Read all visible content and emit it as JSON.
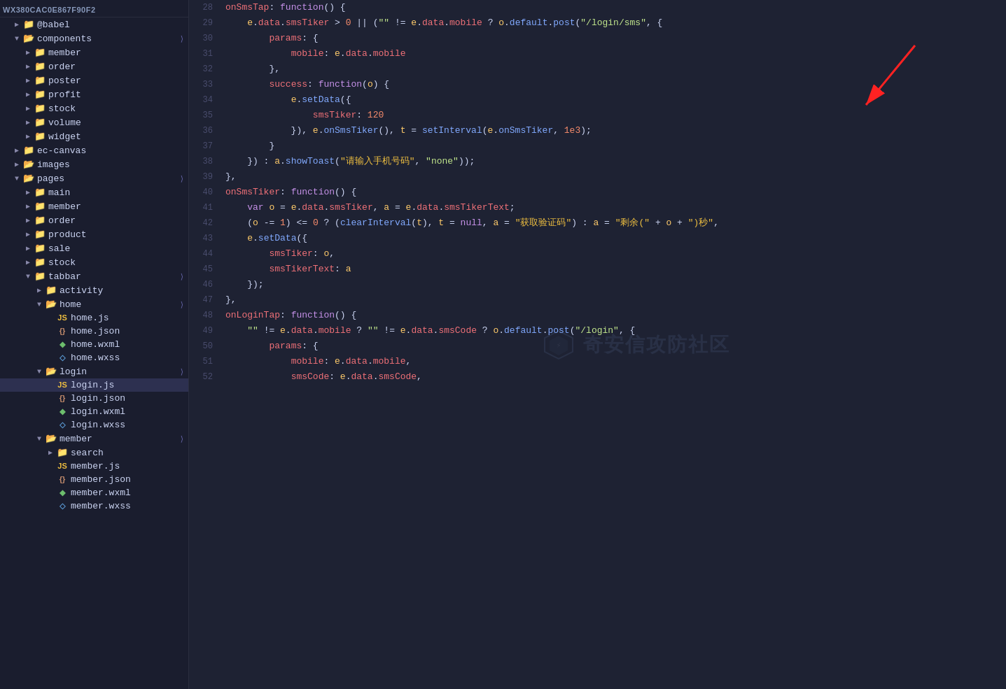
{
  "sidebar": {
    "title": "WX380CAC0E867F90F2",
    "items": [
      {
        "id": "babel",
        "label": "@babel",
        "type": "folder",
        "indent": 1,
        "expanded": false,
        "arrow": "▶"
      },
      {
        "id": "components",
        "label": "components",
        "type": "folder-blue",
        "indent": 1,
        "expanded": true,
        "arrow": "▼"
      },
      {
        "id": "member",
        "label": "member",
        "type": "folder",
        "indent": 2,
        "expanded": false,
        "arrow": "▶"
      },
      {
        "id": "order",
        "label": "order",
        "type": "folder",
        "indent": 2,
        "expanded": false,
        "arrow": "▶"
      },
      {
        "id": "poster",
        "label": "poster",
        "type": "folder",
        "indent": 2,
        "expanded": false,
        "arrow": "▶"
      },
      {
        "id": "profit",
        "label": "profit",
        "type": "folder",
        "indent": 2,
        "expanded": false,
        "arrow": "▶"
      },
      {
        "id": "stock",
        "label": "stock",
        "type": "folder",
        "indent": 2,
        "expanded": false,
        "arrow": "▶"
      },
      {
        "id": "volume",
        "label": "volume",
        "type": "folder",
        "indent": 2,
        "expanded": false,
        "arrow": "▶"
      },
      {
        "id": "widget",
        "label": "widget",
        "type": "folder",
        "indent": 2,
        "expanded": false,
        "arrow": "▶"
      },
      {
        "id": "ec-canvas",
        "label": "ec-canvas",
        "type": "folder",
        "indent": 1,
        "expanded": false,
        "arrow": "▶"
      },
      {
        "id": "images",
        "label": "images",
        "type": "folder-green",
        "indent": 1,
        "expanded": false,
        "arrow": "▶"
      },
      {
        "id": "pages",
        "label": "pages",
        "type": "folder-blue",
        "indent": 1,
        "expanded": true,
        "arrow": "▼"
      },
      {
        "id": "main",
        "label": "main",
        "type": "folder",
        "indent": 2,
        "expanded": false,
        "arrow": "▶"
      },
      {
        "id": "member2",
        "label": "member",
        "type": "folder",
        "indent": 2,
        "expanded": false,
        "arrow": "▶"
      },
      {
        "id": "order2",
        "label": "order",
        "type": "folder",
        "indent": 2,
        "expanded": false,
        "arrow": "▶"
      },
      {
        "id": "product",
        "label": "product",
        "type": "folder",
        "indent": 2,
        "expanded": false,
        "arrow": "▶"
      },
      {
        "id": "sale",
        "label": "sale",
        "type": "folder",
        "indent": 2,
        "expanded": false,
        "arrow": "▶"
      },
      {
        "id": "stock2",
        "label": "stock",
        "type": "folder",
        "indent": 2,
        "expanded": false,
        "arrow": "▶"
      },
      {
        "id": "tabbar",
        "label": "tabbar",
        "type": "folder",
        "indent": 2,
        "expanded": true,
        "arrow": "▼"
      },
      {
        "id": "activity",
        "label": "activity",
        "type": "folder",
        "indent": 3,
        "expanded": false,
        "arrow": "▶"
      },
      {
        "id": "home",
        "label": "home",
        "type": "folder-blue",
        "indent": 3,
        "expanded": true,
        "arrow": "▼"
      },
      {
        "id": "home-js",
        "label": "home.js",
        "type": "js",
        "indent": 4,
        "expanded": false,
        "arrow": ""
      },
      {
        "id": "home-json",
        "label": "home.json",
        "type": "json",
        "indent": 4,
        "expanded": false,
        "arrow": ""
      },
      {
        "id": "home-wxml",
        "label": "home.wxml",
        "type": "wxml",
        "indent": 4,
        "expanded": false,
        "arrow": ""
      },
      {
        "id": "home-wxss",
        "label": "home.wxss",
        "type": "wxss",
        "indent": 4,
        "expanded": false,
        "arrow": ""
      },
      {
        "id": "login",
        "label": "login",
        "type": "folder-blue",
        "indent": 3,
        "expanded": true,
        "arrow": "▼"
      },
      {
        "id": "login-js",
        "label": "login.js",
        "type": "js",
        "indent": 4,
        "expanded": false,
        "arrow": "",
        "active": true
      },
      {
        "id": "login-json",
        "label": "login.json",
        "type": "json",
        "indent": 4,
        "expanded": false,
        "arrow": ""
      },
      {
        "id": "login-wxml",
        "label": "login.wxml",
        "type": "wxml",
        "indent": 4,
        "expanded": false,
        "arrow": ""
      },
      {
        "id": "login-wxss",
        "label": "login.wxss",
        "type": "wxss",
        "indent": 4,
        "expanded": false,
        "arrow": ""
      },
      {
        "id": "member3",
        "label": "member",
        "type": "folder-blue",
        "indent": 3,
        "expanded": true,
        "arrow": "▼"
      },
      {
        "id": "search",
        "label": "search",
        "type": "folder",
        "indent": 4,
        "expanded": false,
        "arrow": "▶"
      },
      {
        "id": "member-js",
        "label": "member.js",
        "type": "js",
        "indent": 4,
        "expanded": false,
        "arrow": ""
      },
      {
        "id": "member-json",
        "label": "member.json",
        "type": "json",
        "indent": 4,
        "expanded": false,
        "arrow": ""
      },
      {
        "id": "member-wxml",
        "label": "member.wxml",
        "type": "wxml",
        "indent": 4,
        "expanded": false,
        "arrow": ""
      },
      {
        "id": "member-wxss",
        "label": "member.wxss",
        "type": "wxss",
        "indent": 4,
        "expanded": false,
        "arrow": ""
      }
    ]
  },
  "editor": {
    "lines": [
      28,
      29,
      30,
      31,
      32,
      33,
      34,
      35,
      36,
      37,
      38,
      39,
      40,
      41,
      42,
      43,
      44,
      45,
      46,
      47,
      48,
      49,
      50,
      51,
      52
    ]
  },
  "watermark": {
    "text": "奇安信攻防社区"
  }
}
